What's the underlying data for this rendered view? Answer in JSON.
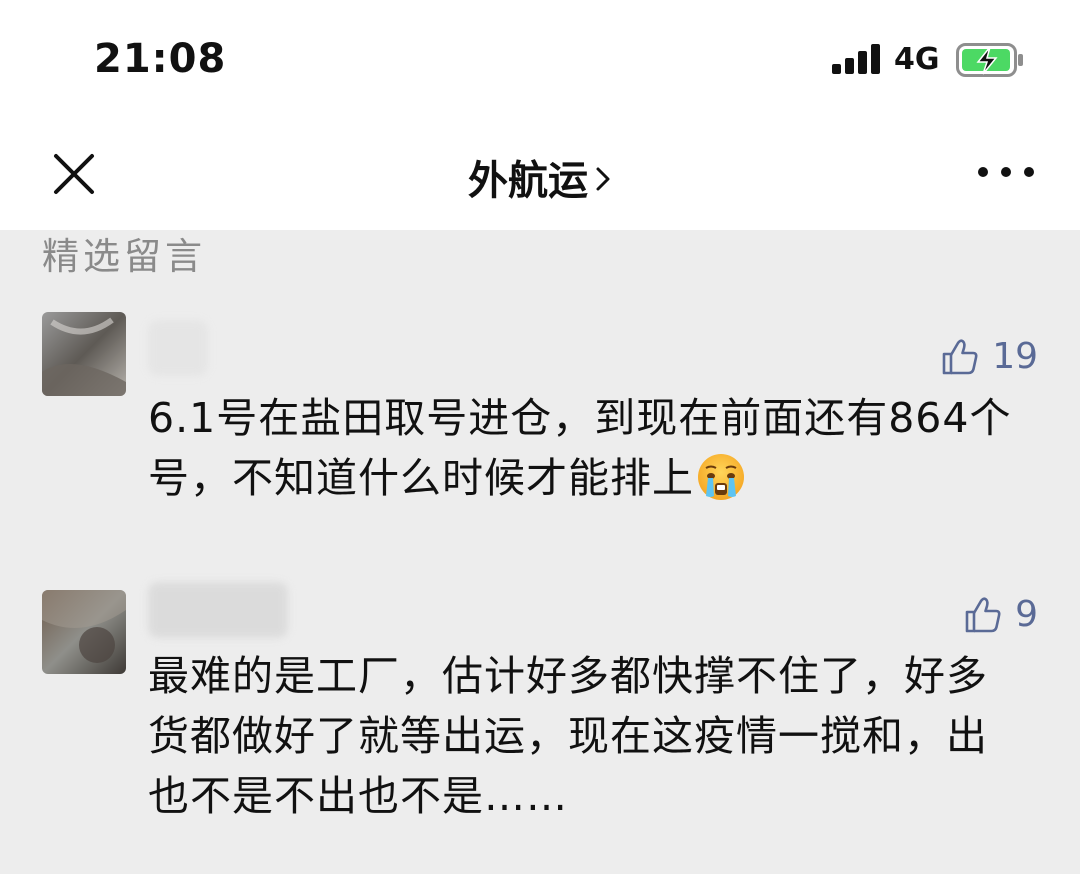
{
  "status_bar": {
    "time": "21:08",
    "network": "4G",
    "icons": [
      "signal-bars-icon",
      "battery-charging-icon"
    ],
    "battery_color": "#4cd964"
  },
  "nav": {
    "title": "外航运",
    "title_chevron": ">",
    "icons": [
      "close-icon",
      "more-icon"
    ]
  },
  "section": {
    "label": "精选留言"
  },
  "comments": [
    {
      "likes": "19",
      "text_line1": "6.1号在盐田取号进仓，到现在前面还有864个",
      "text_line2": "号，不知道什么时候才能排上",
      "emoji": "crying-face-emoji"
    },
    {
      "likes": "9",
      "text_line1": "最难的是工厂，估计好多都快撑不住了，好多",
      "text_line2": "货都做好了就等出运，现在这疫情一搅和，出",
      "text_line3": "也不是不出也不是……"
    }
  ],
  "colors": {
    "background": "#ededed",
    "header": "#ffffff",
    "like_accent": "#5a6a96",
    "section_label": "#8a8a8a"
  }
}
